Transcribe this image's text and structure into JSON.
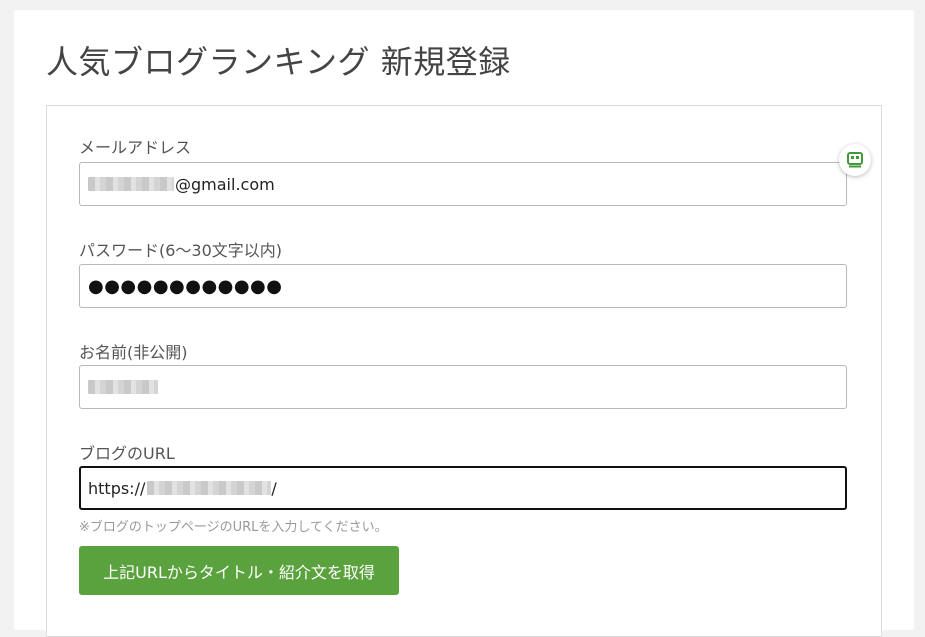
{
  "page": {
    "title": "人気ブログランキング 新規登録"
  },
  "form": {
    "email": {
      "label": "メールアドレス",
      "value_visible": "@gmail.com"
    },
    "password": {
      "label": "パスワード(6〜30文字以内)",
      "value_masked": "●●●●●●●●●●●●"
    },
    "name": {
      "label": "お名前(非公開)"
    },
    "blog_url": {
      "label": "ブログのURL",
      "value_prefix": "https://",
      "value_suffix": "/",
      "hint": "※ブログのトップページのURLを入力してください。"
    },
    "fetch_button": {
      "label": "上記URLからタイトル・紹介文を取得"
    }
  },
  "icons": {
    "password_helper": "password-manager-icon"
  },
  "colors": {
    "button": "#5aa23d",
    "helper_icon": "#3f9a3a"
  }
}
